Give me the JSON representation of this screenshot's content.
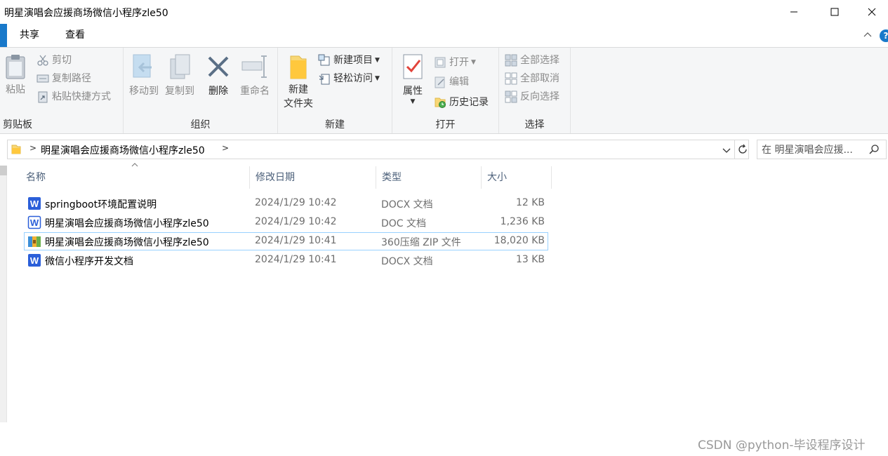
{
  "window": {
    "title": "明星演唱会应援商场微信小程序zle50"
  },
  "tabs": [
    {
      "label": "共享"
    },
    {
      "label": "查看"
    }
  ],
  "help": {
    "label": "?"
  },
  "ribbon": {
    "clipboard": {
      "paste": "粘贴",
      "cut": "剪切",
      "copy_path": "复制路径",
      "paste_shortcut": "粘贴快捷方式",
      "group_label": "剪贴板"
    },
    "organize": {
      "move_to": "移动到",
      "copy_to": "复制到",
      "delete": "删除",
      "rename": "重命名",
      "group_label": "组织"
    },
    "new": {
      "new_folder_line1": "新建",
      "new_folder_line2": "文件夹",
      "new_item": "新建项目",
      "easy_access": "轻松访问",
      "group_label": "新建"
    },
    "open": {
      "properties": "属性",
      "open": "打开",
      "edit": "编辑",
      "history": "历史记录",
      "group_label": "打开"
    },
    "select": {
      "select_all": "全部选择",
      "select_none": "全部取消",
      "invert": "反向选择",
      "group_label": "选择"
    }
  },
  "address": {
    "path": "明星演唱会应援商场微信小程序zle50"
  },
  "search": {
    "placeholder": "在 明星演唱会应援..."
  },
  "columns": {
    "name": "名称",
    "date": "修改日期",
    "type": "类型",
    "size": "大小"
  },
  "files": [
    {
      "name": "springboot环境配置说明",
      "date": "2024/1/29 10:42",
      "type": "DOCX 文档",
      "size": "12 KB",
      "icon": "word-docx-icon"
    },
    {
      "name": "明星演唱会应援商场微信小程序zle50",
      "date": "2024/1/29 10:42",
      "type": "DOC 文档",
      "size": "1,236 KB",
      "icon": "word-doc-icon"
    },
    {
      "name": "明星演唱会应援商场微信小程序zle50",
      "date": "2024/1/29 10:41",
      "type": "360压缩 ZIP 文件",
      "size": "18,020 KB",
      "icon": "zip-archive-icon"
    },
    {
      "name": "微信小程序开发文档",
      "date": "2024/1/29 10:41",
      "type": "DOCX 文档",
      "size": "13 KB",
      "icon": "word-docx-icon"
    }
  ],
  "watermark": "CSDN @python-毕设程序设计",
  "colors": {
    "accent": "#1979ca",
    "selection_border": "#99d1ff",
    "ribbon_bg": "#f5f6f7",
    "header_text": "#4c607a"
  }
}
